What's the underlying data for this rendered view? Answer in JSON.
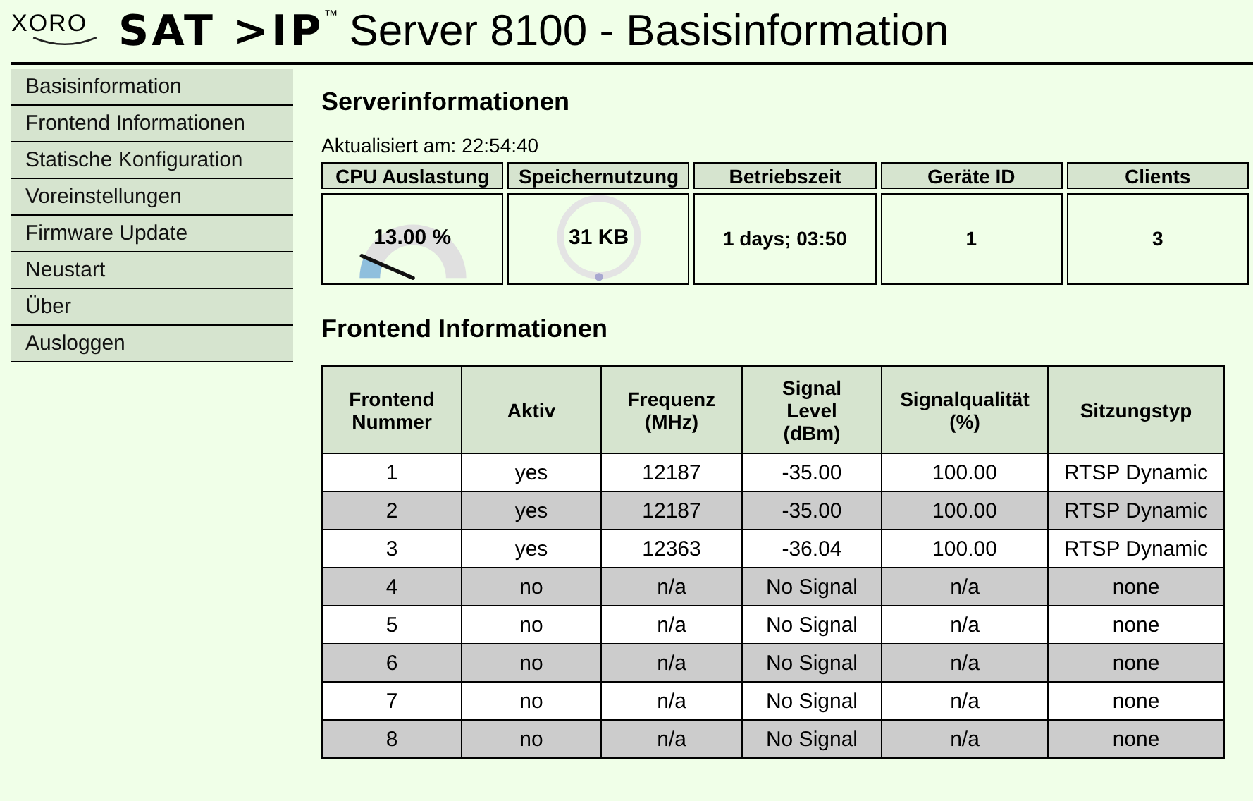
{
  "header": {
    "logo_brand": "XORO",
    "logo_product": "SAT >IP",
    "trademark": "™",
    "title": "Server 8100 - Basisinformation"
  },
  "sidebar": {
    "items": [
      {
        "label": "Basisinformation"
      },
      {
        "label": "Frontend Informationen"
      },
      {
        "label": "Statische Konfiguration"
      },
      {
        "label": "Voreinstellungen"
      },
      {
        "label": "Firmware Update"
      },
      {
        "label": "Neustart"
      },
      {
        "label": "Über"
      },
      {
        "label": "Ausloggen"
      }
    ]
  },
  "server": {
    "heading": "Serverinformationen",
    "updated": "Aktualisiert am: 22:54:40",
    "stats": [
      {
        "kind": "gauge",
        "label": "CPU Auslastung",
        "value": "13.00 %",
        "level": 0.13
      },
      {
        "kind": "ring",
        "label": "Speichernutzung",
        "value": "31 KB"
      },
      {
        "kind": "text",
        "label": "Betriebszeit",
        "value": "1 days; 03:50"
      },
      {
        "kind": "text",
        "label": "Geräte ID",
        "value": "1"
      },
      {
        "kind": "text",
        "label": "Clients",
        "value": "3"
      }
    ]
  },
  "frontends": {
    "heading": "Frontend Informationen",
    "columns": [
      "Frontend\nNummer",
      "Aktiv",
      "Frequenz\n(MHz)",
      "Signal\nLevel\n(dBm)",
      "Signalqualität\n(%)",
      "Sitzungstyp"
    ],
    "rows": [
      [
        "1",
        "yes",
        "12187",
        "-35.00",
        "100.00",
        "RTSP Dynamic"
      ],
      [
        "2",
        "yes",
        "12187",
        "-35.00",
        "100.00",
        "RTSP Dynamic"
      ],
      [
        "3",
        "yes",
        "12363",
        "-36.04",
        "100.00",
        "RTSP Dynamic"
      ],
      [
        "4",
        "no",
        "n/a",
        "No Signal",
        "n/a",
        "none"
      ],
      [
        "5",
        "no",
        "n/a",
        "No Signal",
        "n/a",
        "none"
      ],
      [
        "6",
        "no",
        "n/a",
        "No Signal",
        "n/a",
        "none"
      ],
      [
        "7",
        "no",
        "n/a",
        "No Signal",
        "n/a",
        "none"
      ],
      [
        "8",
        "no",
        "n/a",
        "No Signal",
        "n/a",
        "none"
      ]
    ]
  }
}
